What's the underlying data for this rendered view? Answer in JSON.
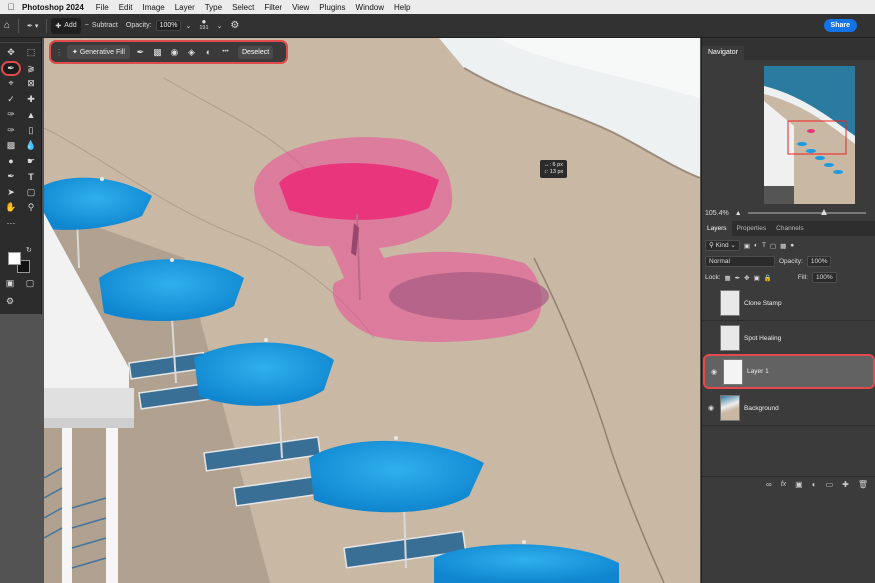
{
  "menubar": {
    "apple": "",
    "app_name": "Photoshop 2024",
    "items": [
      "File",
      "Edit",
      "Image",
      "Layer",
      "Type",
      "Select",
      "Filter",
      "View",
      "Plugins",
      "Window",
      "Help"
    ]
  },
  "options_bar": {
    "add_label": "Add",
    "subtract_label": "Subtract",
    "opacity_label": "Opacity:",
    "opacity_value": "100%",
    "brush_size": "191",
    "share_label": "Share"
  },
  "contextual_bar": {
    "generative_fill_label": "Generative Fill",
    "deselect_label": "Deselect",
    "more_label": "•••"
  },
  "brush_tooltip": {
    "width": "↔: 6 px",
    "height": "↕: 13 px"
  },
  "navigator": {
    "title": "Navigator",
    "zoom": "105.4%"
  },
  "panel_tabs": [
    "Layers",
    "Properties",
    "Channels"
  ],
  "layers_panel": {
    "kind_label": "Kind",
    "blend_mode": "Normal",
    "opacity_label": "Opacity:",
    "opacity_value": "100%",
    "lock_label": "Lock:",
    "fill_label": "Fill:",
    "fill_value": "100%",
    "layers": [
      {
        "name": "Clone Stamp",
        "visible": false
      },
      {
        "name": "Spot Healing",
        "visible": false
      },
      {
        "name": "Layer 1",
        "visible": true,
        "selected": true
      },
      {
        "name": "Background",
        "visible": true
      }
    ]
  },
  "colors": {
    "accent_highlight": "#e14b4b",
    "share_blue": "#1473e6",
    "umbrella_blue": "#1c9be0",
    "selection_pink": "#e8418a"
  }
}
